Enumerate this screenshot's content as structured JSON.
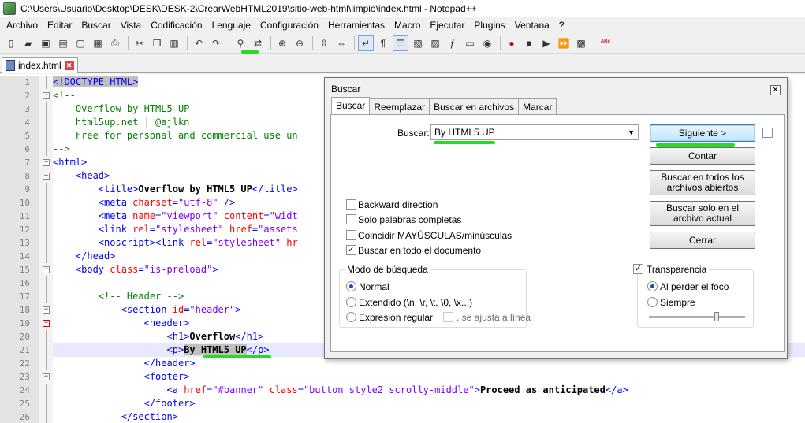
{
  "window": {
    "title": "C:\\Users\\Usuario\\Desktop\\DESK\\DESK-2\\CrearWebHTML2019\\sitio-web-html\\limpio\\index.html - Notepad++"
  },
  "menu": [
    "Archivo",
    "Editar",
    "Buscar",
    "Vista",
    "Codificación",
    "Lenguaje",
    "Configuración",
    "Herramientas",
    "Macro",
    "Ejecutar",
    "Plugins",
    "Ventana",
    "?"
  ],
  "toolbar": {
    "buttons": [
      {
        "name": "new-file-icon",
        "glyph": "▯"
      },
      {
        "name": "open-file-icon",
        "glyph": "▰"
      },
      {
        "name": "save-icon",
        "glyph": "▣"
      },
      {
        "name": "save-all-icon",
        "glyph": "▤"
      },
      {
        "name": "close-icon",
        "glyph": "▢"
      },
      {
        "name": "close-all-icon",
        "glyph": "▦"
      },
      {
        "name": "print-icon",
        "glyph": "⎙"
      },
      {
        "name": "sep"
      },
      {
        "name": "cut-icon",
        "glyph": "✂"
      },
      {
        "name": "copy-icon",
        "glyph": "❐"
      },
      {
        "name": "paste-icon",
        "glyph": "▥"
      },
      {
        "name": "sep"
      },
      {
        "name": "undo-icon",
        "glyph": "↶"
      },
      {
        "name": "redo-icon",
        "glyph": "↷"
      },
      {
        "name": "sep"
      },
      {
        "name": "find-icon",
        "glyph": "⚲"
      },
      {
        "name": "replace-icon",
        "glyph": "⇄"
      },
      {
        "name": "sep"
      },
      {
        "name": "zoom-in-icon",
        "glyph": "⊕"
      },
      {
        "name": "zoom-out-icon",
        "glyph": "⊖"
      },
      {
        "name": "sep"
      },
      {
        "name": "sync-vertical-icon",
        "glyph": "⇳"
      },
      {
        "name": "sync-horizontal-icon",
        "glyph": "⇔"
      },
      {
        "name": "sep"
      },
      {
        "name": "word-wrap-icon",
        "glyph": "↵"
      },
      {
        "name": "show-all-chars-icon",
        "glyph": "¶"
      },
      {
        "name": "indent-guide-icon",
        "glyph": "☰"
      },
      {
        "name": "udl-icon",
        "glyph": "▧"
      },
      {
        "name": "doc-map-icon",
        "glyph": "▨"
      },
      {
        "name": "function-list-icon",
        "glyph": "ƒ"
      },
      {
        "name": "folder-workspace-icon",
        "glyph": "▭"
      },
      {
        "name": "monitoring-icon",
        "glyph": "◉"
      },
      {
        "name": "sep"
      },
      {
        "name": "record-macro-icon",
        "glyph": "●"
      },
      {
        "name": "stop-macro-icon",
        "glyph": "■"
      },
      {
        "name": "play-macro-icon",
        "glyph": "▶"
      },
      {
        "name": "play-macro-multiple-icon",
        "glyph": "⏩"
      },
      {
        "name": "save-macro-icon",
        "glyph": "▩"
      },
      {
        "name": "sep"
      },
      {
        "name": "spell-check-icon",
        "glyph": "ᴬᴮᶜ"
      }
    ]
  },
  "tab": {
    "label": "index.html"
  },
  "editor": {
    "lines": [
      {
        "n": "1",
        "parts": [
          [
            "hl",
            "<!DOCTYPE HTML>"
          ]
        ]
      },
      {
        "n": "2",
        "parts": [
          [
            "cmt",
            "<!--"
          ]
        ]
      },
      {
        "n": "3",
        "parts": [
          [
            "cmt",
            "    Overflow by HTML5 UP"
          ]
        ]
      },
      {
        "n": "4",
        "parts": [
          [
            "cmt",
            "    html5up.net | @ajlkn"
          ]
        ]
      },
      {
        "n": "5",
        "parts": [
          [
            "cmt",
            "    Free for personal and commercial use un"
          ]
        ]
      },
      {
        "n": "6",
        "parts": [
          [
            "cmt",
            "-->"
          ]
        ]
      },
      {
        "n": "7",
        "parts": [
          [
            "tag",
            "<html>"
          ]
        ]
      },
      {
        "n": "8",
        "parts": [
          [
            "plain",
            "    "
          ],
          [
            "tag",
            "<head>"
          ]
        ]
      },
      {
        "n": "9",
        "parts": [
          [
            "plain",
            "        "
          ],
          [
            "tag",
            "<title>"
          ],
          [
            "txt",
            "Overflow by HTML5 UP"
          ],
          [
            "tag",
            "</title>"
          ]
        ]
      },
      {
        "n": "10",
        "parts": [
          [
            "plain",
            "        "
          ],
          [
            "tag",
            "<meta "
          ],
          [
            "attr",
            "charset"
          ],
          [
            "tag",
            "="
          ],
          [
            "val",
            "\"utf-8\""
          ],
          [
            "tag",
            " />"
          ]
        ]
      },
      {
        "n": "11",
        "parts": [
          [
            "plain",
            "        "
          ],
          [
            "tag",
            "<meta "
          ],
          [
            "attr",
            "name"
          ],
          [
            "tag",
            "="
          ],
          [
            "val",
            "\"viewport\""
          ],
          [
            "attr",
            " content"
          ],
          [
            "tag",
            "="
          ],
          [
            "val",
            "\"widt"
          ]
        ]
      },
      {
        "n": "12",
        "parts": [
          [
            "plain",
            "        "
          ],
          [
            "tag",
            "<link "
          ],
          [
            "attr",
            "rel"
          ],
          [
            "tag",
            "="
          ],
          [
            "val",
            "\"stylesheet\""
          ],
          [
            "attr",
            " href"
          ],
          [
            "tag",
            "="
          ],
          [
            "val",
            "\"assets"
          ]
        ]
      },
      {
        "n": "13",
        "parts": [
          [
            "plain",
            "        "
          ],
          [
            "tag",
            "<noscript><link "
          ],
          [
            "attr",
            "rel"
          ],
          [
            "tag",
            "="
          ],
          [
            "val",
            "\"stylesheet\""
          ],
          [
            "attr",
            " hr"
          ]
        ]
      },
      {
        "n": "14",
        "parts": [
          [
            "plain",
            "    "
          ],
          [
            "tag",
            "</head>"
          ]
        ]
      },
      {
        "n": "15",
        "parts": [
          [
            "plain",
            "    "
          ],
          [
            "tag",
            "<body "
          ],
          [
            "attr",
            "class"
          ],
          [
            "tag",
            "="
          ],
          [
            "val",
            "\"is-preload\""
          ],
          [
            "tag",
            ">"
          ]
        ]
      },
      {
        "n": "16",
        "parts": []
      },
      {
        "n": "17",
        "parts": [
          [
            "plain",
            "        "
          ],
          [
            "cmt",
            "<!-- Header -->"
          ]
        ]
      },
      {
        "n": "18",
        "parts": [
          [
            "plain",
            "            "
          ],
          [
            "tag",
            "<section "
          ],
          [
            "attr",
            "id"
          ],
          [
            "tag",
            "="
          ],
          [
            "val",
            "\"header\""
          ],
          [
            "tag",
            ">"
          ]
        ]
      },
      {
        "n": "19",
        "parts": [
          [
            "plain",
            "                "
          ],
          [
            "tag",
            "<header>"
          ]
        ]
      },
      {
        "n": "20",
        "parts": [
          [
            "plain",
            "                    "
          ],
          [
            "tag",
            "<h1>"
          ],
          [
            "txt",
            "Overflow"
          ],
          [
            "tag",
            "</h1>"
          ]
        ]
      },
      {
        "n": "21",
        "parts": [
          [
            "plain",
            "                    "
          ],
          [
            "tag",
            "<p>"
          ],
          [
            "hltxt",
            "By HTML5 UP"
          ],
          [
            "tag",
            "</p>"
          ]
        ]
      },
      {
        "n": "22",
        "parts": [
          [
            "plain",
            "                "
          ],
          [
            "tag",
            "</header>"
          ]
        ]
      },
      {
        "n": "23",
        "parts": [
          [
            "plain",
            "                "
          ],
          [
            "tag",
            "<footer>"
          ]
        ]
      },
      {
        "n": "24",
        "parts": [
          [
            "plain",
            "                    "
          ],
          [
            "tag",
            "<a "
          ],
          [
            "attr",
            "href"
          ],
          [
            "tag",
            "="
          ],
          [
            "val",
            "\"#banner\""
          ],
          [
            "attr",
            " class"
          ],
          [
            "tag",
            "="
          ],
          [
            "val",
            "\"button style2 scrolly-middle\""
          ],
          [
            "tag",
            ">"
          ],
          [
            "txt",
            "Proceed as anticipated"
          ],
          [
            "tag",
            "</a>"
          ]
        ]
      },
      {
        "n": "25",
        "parts": [
          [
            "plain",
            "                "
          ],
          [
            "tag",
            "</footer>"
          ]
        ]
      },
      {
        "n": "26",
        "parts": [
          [
            "plain",
            "            "
          ],
          [
            "tag",
            "</section>"
          ]
        ]
      }
    ]
  },
  "dialog": {
    "title": "Buscar",
    "tabs": [
      "Buscar",
      "Reemplazar",
      "Buscar en archivos",
      "Marcar"
    ],
    "search_label": "Buscar:",
    "search_value": "By HTML5 UP",
    "buttons": {
      "next": "Siguiente >",
      "count": "Contar",
      "find_all_open": "Buscar en todos los archivos abiertos",
      "find_in_current": "Buscar solo en el archivo actual",
      "close": "Cerrar"
    },
    "options": {
      "backward": "Backward direction",
      "whole_word": "Solo palabras completas",
      "match_case": "Coincidir MAYÚSCULAS/minúsculas",
      "wrap": "Buscar en todo el documento"
    },
    "search_mode": {
      "title": "Modo de búsqueda",
      "normal": "Normal",
      "extended": "Extendido (\\n, \\r, \\t, \\0, \\x...)",
      "regex": "Expresión regular",
      "dot_newline": ". se ajusta a línea"
    },
    "transparency": {
      "title": "Transparencia",
      "on_lose_focus": "Al perder el foco",
      "always": "Siempre",
      "level": 0.7
    }
  }
}
